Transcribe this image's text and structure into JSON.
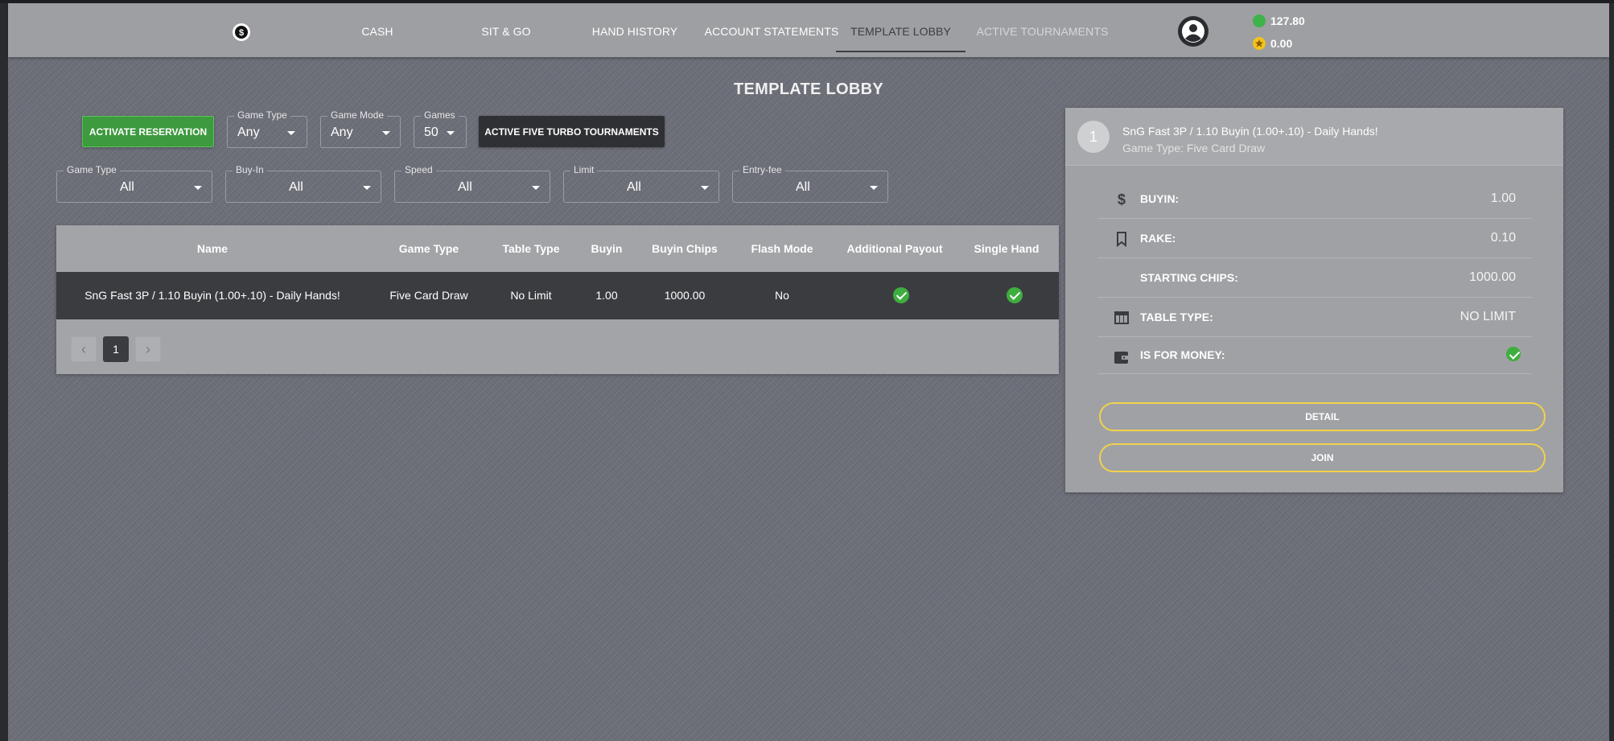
{
  "nav": {
    "logo_alt": "logo",
    "items": [
      {
        "label": "CASH"
      },
      {
        "label": "SIT & GO"
      },
      {
        "label": "HAND HISTORY"
      },
      {
        "label": "ACCOUNT STATEMENTS"
      },
      {
        "label": "TEMPLATE LOBBY"
      },
      {
        "label": "ACTIVE TOURNAMENTS"
      }
    ],
    "active_index": 4,
    "balances": {
      "cash": "127.80",
      "points": "0.00"
    }
  },
  "page": {
    "title": "TEMPLATE LOBBY"
  },
  "toolbar": {
    "activate_label": "ACTIVATE RESERVATION",
    "game_type": {
      "legend": "Game Type",
      "value": "Any"
    },
    "game_mode": {
      "legend": "Game Mode",
      "value": "Any"
    },
    "games": {
      "legend": "Games",
      "value": "50"
    },
    "turbo_label": "ACTIVE FIVE TURBO TOURNAMENTS"
  },
  "filters": [
    {
      "legend": "Game Type",
      "value": "All"
    },
    {
      "legend": "Buy-In",
      "value": "All"
    },
    {
      "legend": "Speed",
      "value": "All"
    },
    {
      "legend": "Limit",
      "value": "All"
    },
    {
      "legend": "Entry-fee",
      "value": "All"
    }
  ],
  "table": {
    "headers": [
      "Name",
      "Game Type",
      "Table Type",
      "Buyin",
      "Buyin Chips",
      "Flash Mode",
      "Additional Payout",
      "Single Hand"
    ],
    "rows": [
      {
        "name": "SnG Fast 3P / 1.10 Buyin (1.00+.10) - Daily Hands!",
        "game_type": "Five Card Draw",
        "table_type": "No Limit",
        "buyin": "1.00",
        "buyin_chips": "1000.00",
        "flash_mode": "No",
        "additional_payout": true,
        "single_hand": true
      }
    ],
    "pagination": {
      "current_page": "1"
    }
  },
  "detail": {
    "number": "1",
    "title": "SnG Fast 3P / 1.10 Buyin (1.00+.10) - Daily Hands!",
    "subtitle": "Game Type: Five Card Draw",
    "rows": {
      "buyin": {
        "label": "BUYIN:",
        "value": "1.00"
      },
      "rake": {
        "label": "RAKE:",
        "value": "0.10"
      },
      "starting_chips": {
        "label": "STARTING CHIPS:",
        "value": "1000.00"
      },
      "table_type": {
        "label": "TABLE TYPE:",
        "value": "NO LIMIT"
      },
      "is_for_money": {
        "label": "IS FOR MONEY:",
        "value": true
      }
    },
    "detail_button": "DETAIL",
    "join_button": "JOIN"
  },
  "colors": {
    "accent_green": "#3d9a3f",
    "outline_yellow": "#f2d14b",
    "check_green": "#3eae3f"
  }
}
